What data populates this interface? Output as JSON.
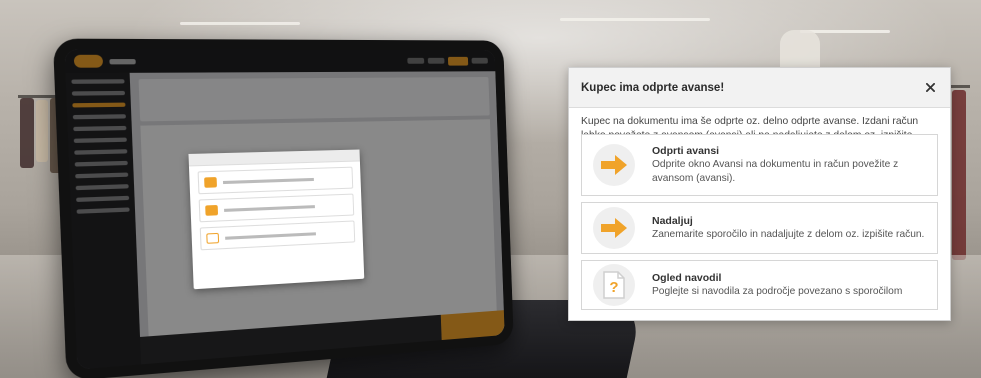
{
  "dialog": {
    "title": "Kupec ima odprte avanse!",
    "message": "Kupec na dokumentu ima še odprte oz. delno odprte avanse. Izdani račun lahko povežete z avansom (avansi) ali pa nadaljujete z delom oz. izpišite račun.",
    "close_icon": "close-icon",
    "options": [
      {
        "title": "Odprti avansi",
        "description": "Odprite okno Avansi na dokumentu in račun povežite z avansom (avansi).",
        "icon": "arrow-right-icon"
      },
      {
        "title": "Nadaljuj",
        "description": "Zanemarite sporočilo in nadaljujte z delom oz. izpišite račun.",
        "icon": "arrow-right-icon"
      },
      {
        "title": "Ogled navodil",
        "description": "Poglejte si navodila za področje povezano s sporočilom",
        "icon": "help-document-icon"
      }
    ]
  },
  "colors": {
    "accent": "#f0a32a",
    "icon_bg": "#efefef",
    "border": "#d6d6d6",
    "header_bg": "#f2f2f2"
  }
}
